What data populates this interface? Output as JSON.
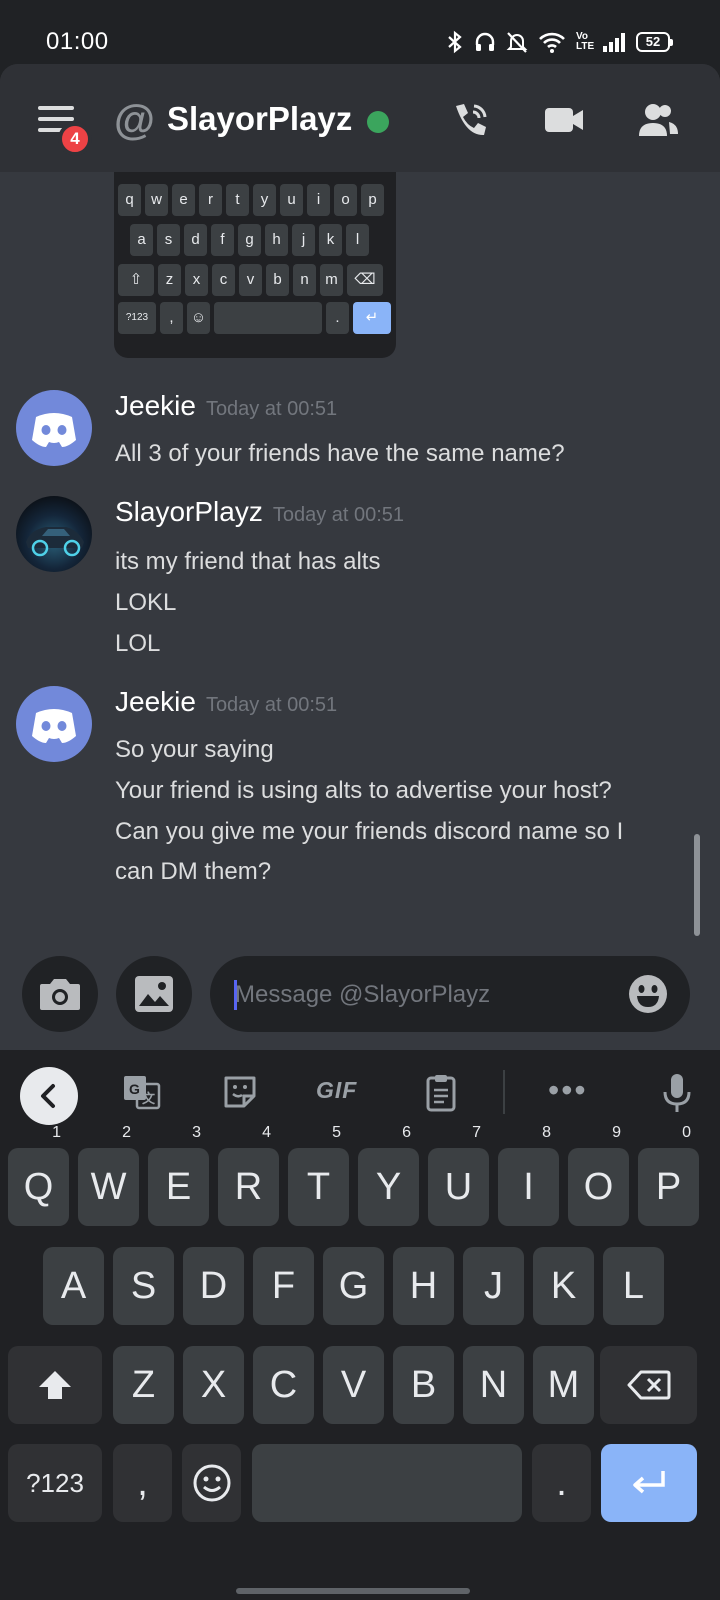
{
  "status_bar": {
    "time": "01:00",
    "network": "Vo LTE",
    "battery": "52",
    "icons": [
      "bluetooth-icon",
      "headphones-icon",
      "mute-icon",
      "wifi-icon",
      "volte-icon",
      "signal-icon",
      "battery-icon"
    ]
  },
  "header": {
    "title": "SlayorPlayz",
    "unread_badge": "4",
    "status_color": "#3ba55d",
    "buttons": [
      "call-icon",
      "video-icon",
      "members-icon"
    ]
  },
  "preview_keyboard": {
    "rows": [
      [
        "q",
        "w",
        "e",
        "r",
        "t",
        "y",
        "u",
        "i",
        "o",
        "p"
      ],
      [
        "a",
        "s",
        "d",
        "f",
        "g",
        "h",
        "j",
        "k",
        "l"
      ],
      [
        "z",
        "x",
        "c",
        "v",
        "b",
        "n",
        "m"
      ]
    ],
    "symbols_label": "?123",
    "comma": ",",
    "period": "."
  },
  "messages": [
    {
      "author": "Jeekie",
      "timestamp": "Today at 00:51",
      "lines": [
        "All 3 of your friends have the same name?"
      ]
    },
    {
      "author": "SlayorPlayz",
      "timestamp": "Today at 00:51",
      "lines": [
        "its my friend that has alts",
        "LOKL",
        "LOL"
      ]
    },
    {
      "author": "Jeekie",
      "timestamp": "Today at 00:51",
      "lines": [
        "So your saying",
        "Your friend is using alts to advertise your host?",
        "Can you give me your friends discord name so I",
        "can DM them?"
      ]
    }
  ],
  "composer": {
    "placeholder": "Message @SlayorPlayz"
  },
  "keyboard": {
    "toolbar": {
      "gif_label": "GIF",
      "more_label": "•••"
    },
    "row1": [
      {
        "key": "Q",
        "num": "1"
      },
      {
        "key": "W",
        "num": "2"
      },
      {
        "key": "E",
        "num": "3"
      },
      {
        "key": "R",
        "num": "4"
      },
      {
        "key": "T",
        "num": "5"
      },
      {
        "key": "Y",
        "num": "6"
      },
      {
        "key": "U",
        "num": "7"
      },
      {
        "key": "I",
        "num": "8"
      },
      {
        "key": "O",
        "num": "9"
      },
      {
        "key": "P",
        "num": "0"
      }
    ],
    "row2": [
      "A",
      "S",
      "D",
      "F",
      "G",
      "H",
      "J",
      "K",
      "L"
    ],
    "row3": [
      "Z",
      "X",
      "C",
      "V",
      "B",
      "N",
      "M"
    ],
    "symbols_label": "?123",
    "comma": ",",
    "period": ".",
    "enter_color": "#8ab4f8"
  }
}
